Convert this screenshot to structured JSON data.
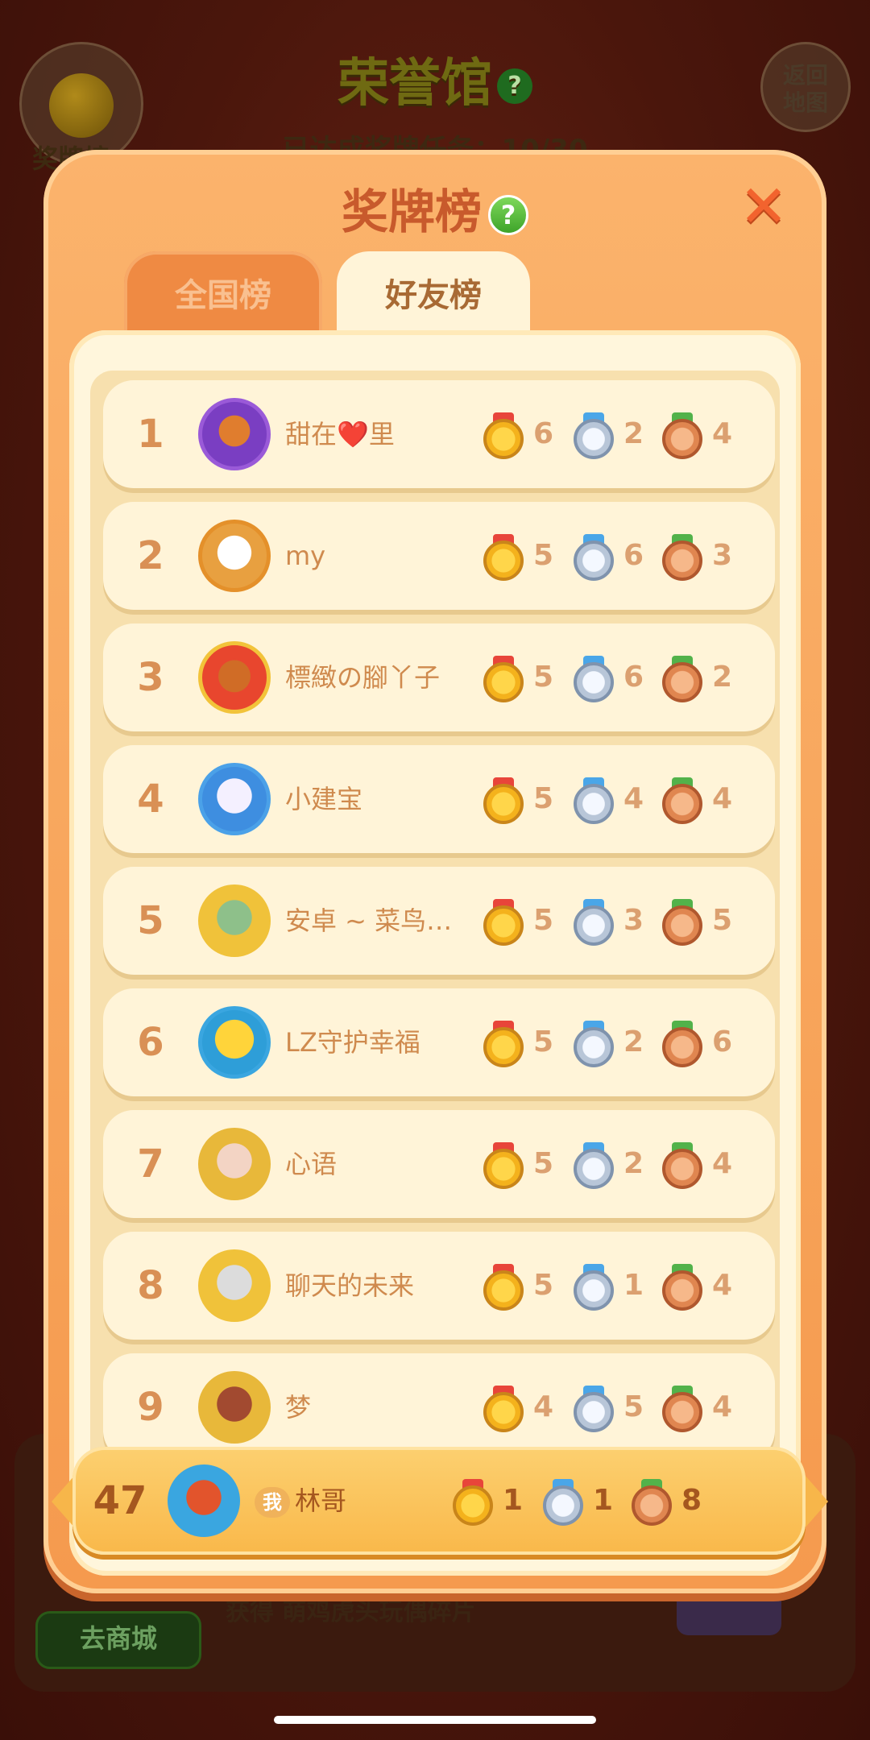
{
  "background": {
    "hall_title": "荣誉馆",
    "hall_help": "?",
    "progress_text": "已达成奖牌任务：10/30",
    "medal_button_label": "奖牌榜",
    "return_button_label": "返回\n地图",
    "shop_button_label": "去商城",
    "bottom_text": "获得 萌鸡虎头玩偶碎片"
  },
  "modal": {
    "title": "奖牌榜",
    "help": "?",
    "close": "✕",
    "tabs": [
      {
        "label": "全国榜",
        "active": false
      },
      {
        "label": "好友榜",
        "active": true
      }
    ]
  },
  "leaderboard": [
    {
      "rank": "1",
      "name": "甜在❤️里",
      "gold": "6",
      "silver": "2",
      "bronze": "4"
    },
    {
      "rank": "2",
      "name": "my",
      "gold": "5",
      "silver": "6",
      "bronze": "3"
    },
    {
      "rank": "3",
      "name": "標緻の腳丫子",
      "gold": "5",
      "silver": "6",
      "bronze": "2"
    },
    {
      "rank": "4",
      "name": "小建宝",
      "gold": "5",
      "silver": "4",
      "bronze": "4"
    },
    {
      "rank": "5",
      "name": "安卓 ~ 菜鸟…",
      "gold": "5",
      "silver": "3",
      "bronze": "5"
    },
    {
      "rank": "6",
      "name": "LZ守护幸福",
      "gold": "5",
      "silver": "2",
      "bronze": "6"
    },
    {
      "rank": "7",
      "name": "心语",
      "gold": "5",
      "silver": "2",
      "bronze": "4"
    },
    {
      "rank": "8",
      "name": "聊天的未来",
      "gold": "5",
      "silver": "1",
      "bronze": "4"
    },
    {
      "rank": "9",
      "name": "梦",
      "gold": "4",
      "silver": "5",
      "bronze": "4"
    }
  ],
  "my_entry": {
    "rank": "47",
    "me_badge": "我",
    "name": "林哥",
    "gold": "1",
    "silver": "1",
    "bronze": "8"
  },
  "colors": {
    "accent": "#f59a4e",
    "row_bg": "#fff4d8",
    "my_row_bg": "#f9b84a"
  }
}
